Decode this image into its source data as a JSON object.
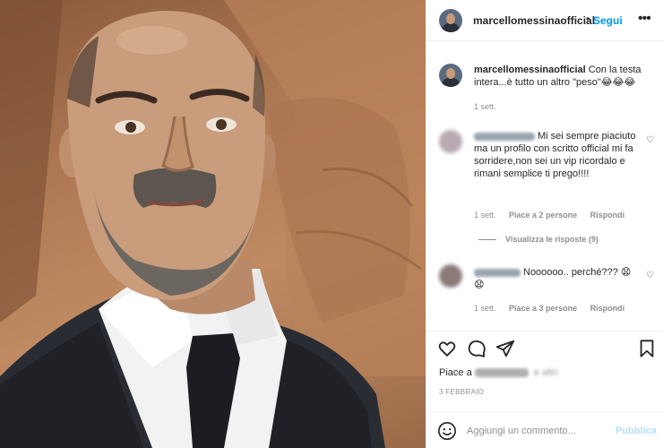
{
  "post": {
    "username": "marcellomessinaofficial",
    "separator": "•",
    "follow_label": "Segui",
    "more_label": "•••"
  },
  "caption": {
    "username": "marcellomessinaofficial",
    "text": "Con la testa intera...è tutto un altro \"peso\"😂😂😂",
    "time": "1 sett."
  },
  "comments": [
    {
      "text": "Mi sei sempre piaciuto ma un profilo con scritto official mi fa sorridere,non sei un vip ricordalo e rimani semplice ti prego!!!!",
      "time": "1 sett.",
      "likes": "Piace a 2 persone",
      "reply": "Rispondi",
      "view_replies": "Visualizza le risposte (9)"
    },
    {
      "text": "Noooooo.. perché??? 😧 😧",
      "time": "1 sett.",
      "likes": "Piace a 3 persone",
      "reply": "Rispondi"
    }
  ],
  "likes_line": {
    "prefix": "Piace a",
    "suffix": "e altri"
  },
  "date": "3 FEBBRAIO",
  "add_comment": {
    "placeholder": "Aggiungi un commento...",
    "publish_label": "Pubblica"
  },
  "icons": [
    "heart-icon",
    "comment-icon",
    "share-icon",
    "bookmark-icon",
    "emoji-icon",
    "more-icon"
  ],
  "colors": {
    "accent": "#0095f6",
    "muted": "#8e8e8e",
    "publish_disabled": "#b2dffc"
  }
}
